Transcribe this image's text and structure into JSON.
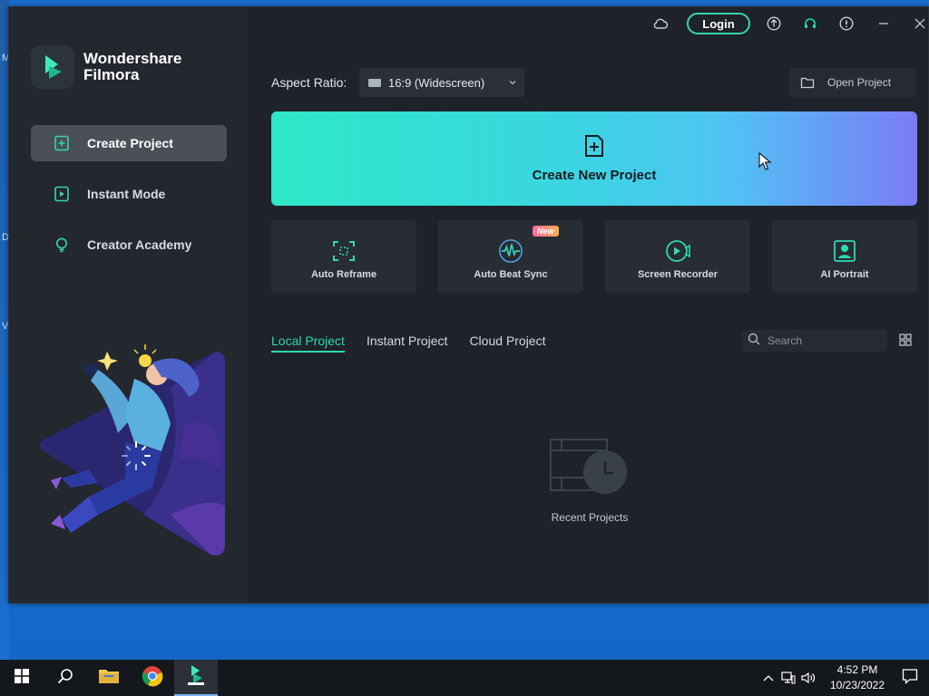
{
  "app": {
    "brand_line1": "Wondershare",
    "brand_line2": "Filmora",
    "accent": "#2fd7b5"
  },
  "sidebar": {
    "items": [
      {
        "label": "Create Project",
        "icon": "plus-square-icon",
        "active": true
      },
      {
        "label": "Instant Mode",
        "icon": "instant-mode-icon",
        "active": false
      },
      {
        "label": "Creator Academy",
        "icon": "lightbulb-icon",
        "active": false
      }
    ]
  },
  "titlebar": {
    "login_label": "Login",
    "icons": [
      "cloud-icon",
      "upload-icon",
      "headset-icon",
      "info-icon",
      "minimize-icon",
      "close-icon"
    ]
  },
  "aspect": {
    "label": "Aspect Ratio:",
    "value": "16:9 (Widescreen)"
  },
  "open_project": {
    "label": "Open Project"
  },
  "create_new": {
    "label": "Create New Project"
  },
  "tools": [
    {
      "label": "Auto Reframe",
      "icon": "reframe-icon"
    },
    {
      "label": "Auto Beat Sync",
      "icon": "beat-sync-icon",
      "badge": "New"
    },
    {
      "label": "Screen Recorder",
      "icon": "screen-recorder-icon"
    },
    {
      "label": "AI Portrait",
      "icon": "ai-portrait-icon"
    }
  ],
  "tabs": [
    {
      "label": "Local Project",
      "active": true
    },
    {
      "label": "Instant Project",
      "active": false
    },
    {
      "label": "Cloud Project",
      "active": false
    }
  ],
  "search": {
    "placeholder": "Search"
  },
  "empty": {
    "label": "Recent Projects"
  },
  "desktop_edge": [
    "M",
    "D",
    "V"
  ],
  "taskbar": {
    "time": "4:52 PM",
    "date": "10/23/2022"
  }
}
